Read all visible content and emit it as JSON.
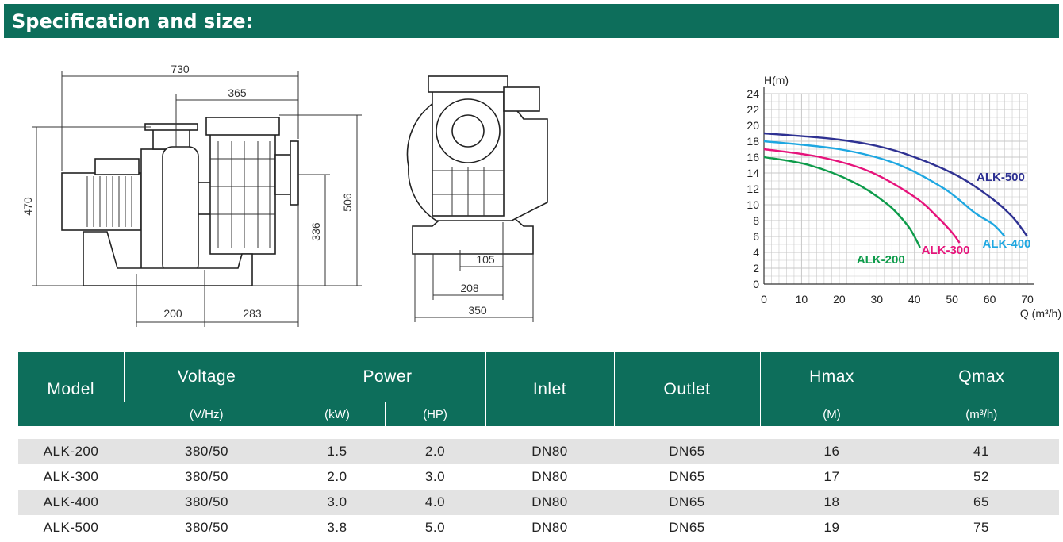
{
  "page": {
    "title": "Specification and size:"
  },
  "dimensions": {
    "side_view": {
      "total_length": "730",
      "half_length": "365",
      "height": "470",
      "height_outlet": "506",
      "inlet_height": "336",
      "base_left": "200",
      "base_right": "283"
    },
    "front_view": {
      "foot_half": "105",
      "foot_span": "208",
      "total_width": "350"
    }
  },
  "chart_data": {
    "type": "line",
    "xlabel": "Q (m³/h)",
    "ylabel": "H(m)",
    "xlim": [
      0,
      70
    ],
    "ylim": [
      0,
      24
    ],
    "x_ticks": [
      "0",
      "10",
      "20",
      "30",
      "40",
      "50",
      "60",
      "70"
    ],
    "y_ticks": [
      "0",
      "2",
      "4",
      "6",
      "8",
      "10",
      "12",
      "14",
      "16",
      "18",
      "20",
      "22",
      "24"
    ],
    "grid": true,
    "series": [
      {
        "name": "ALK-500",
        "color": "#2e3192",
        "x": [
          0,
          20,
          35,
          50,
          60,
          66,
          70
        ],
        "y": [
          19,
          18.2,
          16.8,
          14,
          11,
          8.5,
          6
        ]
      },
      {
        "name": "ALK-400",
        "color": "#1ea7e1",
        "x": [
          0,
          20,
          35,
          48,
          56,
          61,
          64
        ],
        "y": [
          18,
          17,
          15.2,
          12,
          9,
          7.5,
          6
        ]
      },
      {
        "name": "ALK-300",
        "color": "#e6137b",
        "x": [
          0,
          15,
          28,
          40,
          46,
          50,
          52
        ],
        "y": [
          17,
          16,
          14.2,
          11,
          8.5,
          6.5,
          5.2
        ]
      },
      {
        "name": "ALK-200",
        "color": "#0d9b4a",
        "x": [
          0,
          12,
          24,
          33,
          38,
          40,
          41.5
        ],
        "y": [
          16,
          15,
          12.8,
          10,
          7.5,
          6,
          4.6
        ]
      }
    ]
  },
  "table": {
    "headers": {
      "model": "Model",
      "voltage": "Voltage",
      "power": "Power",
      "inlet": "Inlet",
      "outlet": "Outlet",
      "hmax": "Hmax",
      "qmax": "Qmax"
    },
    "units": {
      "voltage": "(V/Hz)",
      "kw": "(kW)",
      "hp": "(HP)",
      "hmax": "(M)",
      "qmax": "(m³/h)"
    },
    "rows": [
      {
        "model": "ALK-200",
        "voltage": "380/50",
        "kw": "1.5",
        "hp": "2.0",
        "inlet": "DN80",
        "outlet": "DN65",
        "hmax": "16",
        "qmax": "41"
      },
      {
        "model": "ALK-300",
        "voltage": "380/50",
        "kw": "2.0",
        "hp": "3.0",
        "inlet": "DN80",
        "outlet": "DN65",
        "hmax": "17",
        "qmax": "52"
      },
      {
        "model": "ALK-400",
        "voltage": "380/50",
        "kw": "3.0",
        "hp": "4.0",
        "inlet": "DN80",
        "outlet": "DN65",
        "hmax": "18",
        "qmax": "65"
      },
      {
        "model": "ALK-500",
        "voltage": "380/50",
        "kw": "3.8",
        "hp": "5.0",
        "inlet": "DN80",
        "outlet": "DN65",
        "hmax": "19",
        "qmax": "75"
      }
    ]
  }
}
